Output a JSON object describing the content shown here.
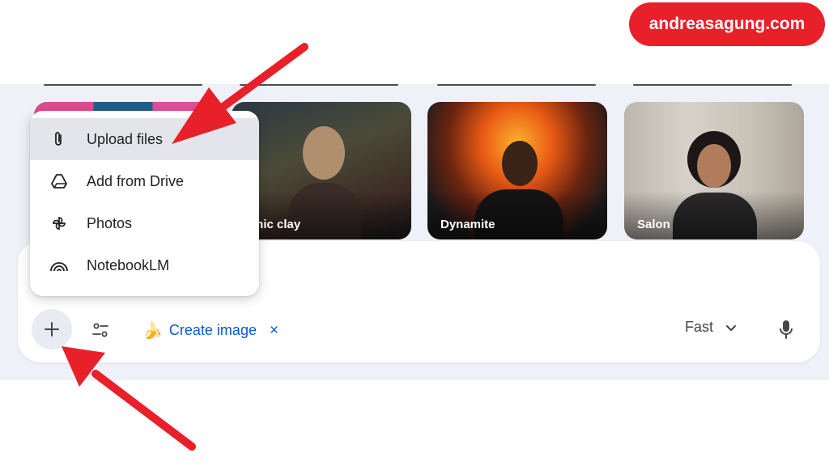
{
  "brand": {
    "text": "andreasagung.com",
    "color": "#e8202a"
  },
  "cards": [
    {
      "label": ""
    },
    {
      "label": "othic clay"
    },
    {
      "label": "Dynamite"
    },
    {
      "label": "Salon"
    }
  ],
  "menu": {
    "items": [
      {
        "label": "Upload files",
        "icon": "paperclip-icon",
        "highlighted": true
      },
      {
        "label": "Add from Drive",
        "icon": "drive-icon",
        "highlighted": false
      },
      {
        "label": "Photos",
        "icon": "photos-pinwheel-icon",
        "highlighted": false
      },
      {
        "label": "NotebookLM",
        "icon": "notebooklm-icon",
        "highlighted": false
      }
    ]
  },
  "toolbar": {
    "plus_icon": "plus-icon",
    "tools_icon": "sliders-icon",
    "chip": {
      "emoji": "🍌",
      "label": "Create image",
      "close": "×"
    },
    "mode": {
      "label": "Fast",
      "icon": "chevron-down-icon"
    },
    "mic_icon": "mic-icon"
  },
  "colors": {
    "accent_blue": "#0b57d0",
    "annotation_red": "#e8202a",
    "band": "#eef1f7"
  }
}
